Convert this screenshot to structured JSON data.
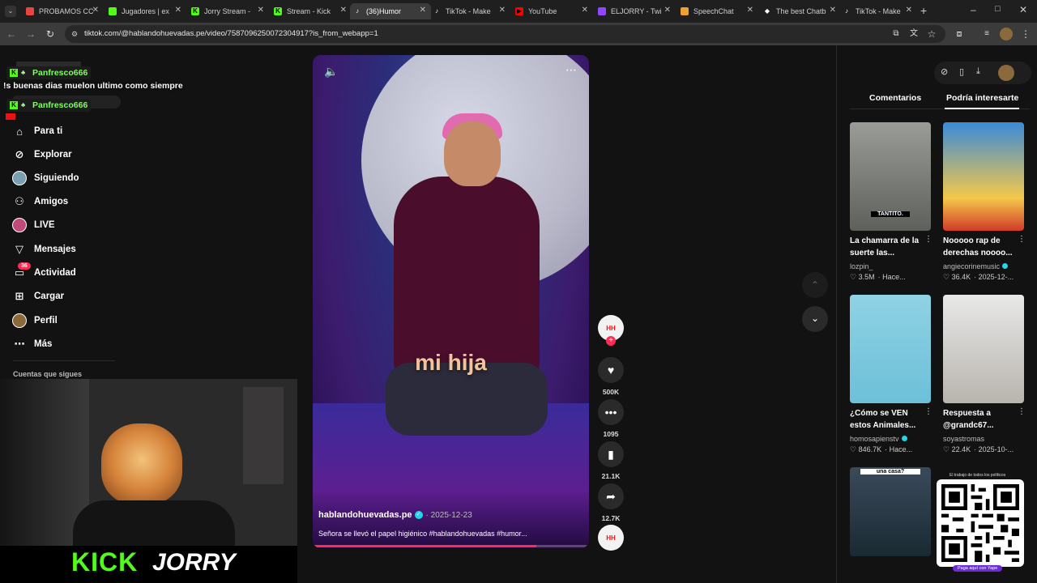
{
  "browser": {
    "tabs": [
      {
        "title": "PROBAMOS CC",
        "fav_color": "#e8453c",
        "fav_glyph": ""
      },
      {
        "title": "Jugadores | ex",
        "fav_color": "#53fc18",
        "fav_glyph": ""
      },
      {
        "title": "Jorry Stream -",
        "fav_color": "#53fc18",
        "fav_glyph": "K"
      },
      {
        "title": "Stream - Kick",
        "fav_color": "#53fc18",
        "fav_glyph": "K"
      },
      {
        "title": "(36)Humor",
        "fav_color": "#ffffff",
        "fav_glyph": "♪"
      },
      {
        "title": "TikTok - Make",
        "fav_color": "#ffffff",
        "fav_glyph": "♪"
      },
      {
        "title": "YouTube",
        "fav_color": "#ff0000",
        "fav_glyph": "▶"
      },
      {
        "title": "ELJORRY - Twi",
        "fav_color": "#9146ff",
        "fav_glyph": ""
      },
      {
        "title": "SpeechChat",
        "fav_color": "#f0a030",
        "fav_glyph": ""
      },
      {
        "title": "The best Chatb",
        "fav_color": "#ffffff",
        "fav_glyph": "◆"
      },
      {
        "title": "TikTok - Make",
        "fav_color": "#ffffff",
        "fav_glyph": "♪"
      }
    ],
    "url": "tiktok.com/@hablandohuevadas.pe/video/7587096250072304917?is_from_webapp=1"
  },
  "overlay": {
    "chat_user": "Panfresco666",
    "chat_message": "!s buenas dias muelon ultimo como siempre",
    "chat_user_2": "Panfresco666"
  },
  "sidebar": {
    "items": [
      {
        "label": "Para ti",
        "icon": "home-icon",
        "glyph": "⌂"
      },
      {
        "label": "Explorar",
        "icon": "compass-icon",
        "glyph": "⊘"
      },
      {
        "label": "Siguiendo",
        "icon": "following-avatar-icon",
        "glyph": ""
      },
      {
        "label": "Amigos",
        "icon": "friends-icon",
        "glyph": "⚇"
      },
      {
        "label": "LIVE",
        "icon": "live-icon",
        "glyph": ""
      },
      {
        "label": "Mensajes",
        "icon": "send-icon",
        "glyph": "▽"
      },
      {
        "label": "Actividad",
        "icon": "inbox-icon",
        "glyph": "▭"
      },
      {
        "label": "Cargar",
        "icon": "upload-icon",
        "glyph": "⊞"
      },
      {
        "label": "Perfil",
        "icon": "profile-avatar-icon",
        "glyph": ""
      },
      {
        "label": "Más",
        "icon": "more-icon",
        "glyph": "⋯"
      }
    ],
    "activity_badge": "36",
    "following_heading": "Cuentas que sigues"
  },
  "stream": {
    "brand": "KICK",
    "streamer": "JORRY"
  },
  "video": {
    "caption_overlay": "mi hija",
    "author": "hablandohuevadas.pe",
    "date": "· 2025-12-23",
    "description": "Señora se llevó el papel higiénico #hablandohuevadas #humor...",
    "progress_fraction": 0.81,
    "likes": "500K",
    "comments": "1095",
    "saves": "21.1K",
    "shares": "12.7K"
  },
  "right_panel": {
    "tab_comments": "Comentarios",
    "tab_related": "Podría interesarte",
    "cards": [
      {
        "title": "La chamarra de la suerte las...",
        "author": "lozpin_",
        "likes": "3.5M",
        "date": "· Hace...",
        "thumb_text": "TANTITO.",
        "verified": false
      },
      {
        "title": "Nooooo rap de derechas noooo...",
        "author": "angiecorinemusic",
        "likes": "36.4K",
        "date": "· 2025-12-...",
        "thumb_text": "",
        "verified": true
      },
      {
        "title": "¿Cómo se VEN estos Animales...",
        "author": "homosapienstv",
        "likes": "846.7K",
        "date": "· Hace...",
        "thumb_text": "",
        "verified": true
      },
      {
        "title": "Respuesta a @grandc67...",
        "author": "soyastromas",
        "likes": "22.4K",
        "date": "· 2025-10-...",
        "thumb_text": "",
        "verified": false
      }
    ],
    "bottom_card_text": "una casa?",
    "qr_caption_top": "El trabajo de todos los políticos",
    "qr_caption_bottom": "Paga aquí con Yape"
  },
  "colors": {
    "accent": "#fe2c55",
    "kick_green": "#53fc18"
  }
}
